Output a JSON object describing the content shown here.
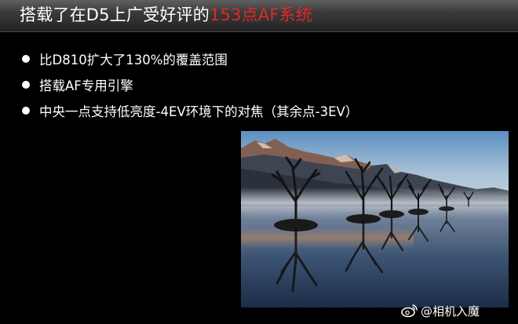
{
  "slide": {
    "title_main": "搭载了在D5上广受好评的",
    "title_highlight": "153点AF系统",
    "accent_color": "#e02828",
    "bullets": [
      "比D810扩大了130%的覆盖范围",
      "搭载AF专用引擎",
      "中央一点支持低亮度-4EV环境下的对焦（其余点-3EV）"
    ]
  },
  "watermark": {
    "handle": "@相机入魔",
    "icon": "weibo-icon"
  }
}
